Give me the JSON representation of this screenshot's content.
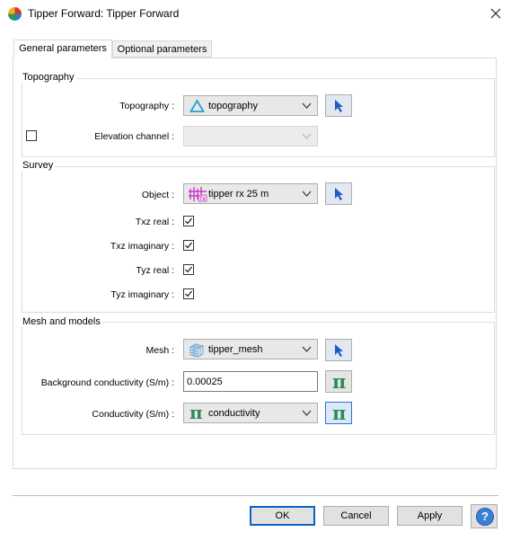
{
  "window": {
    "title": "Tipper Forward: Tipper Forward"
  },
  "tabs": [
    {
      "label": "General parameters"
    },
    {
      "label": "Optional parameters"
    }
  ],
  "topography": {
    "group_title": "Topography",
    "topography_label": "Topography :",
    "topography_value": "topography",
    "elevation_label": "Elevation channel :"
  },
  "survey": {
    "group_title": "Survey",
    "object_label": "Object :",
    "object_value": "tipper rx 25 m",
    "components": [
      {
        "label": "Txz real :",
        "checked": true
      },
      {
        "label": "Txz imaginary :",
        "checked": true
      },
      {
        "label": "Tyz real :",
        "checked": true
      },
      {
        "label": "Tyz imaginary :",
        "checked": true
      }
    ]
  },
  "mesh": {
    "group_title": "Mesh and models",
    "mesh_label": "Mesh :",
    "mesh_value": "tipper_mesh",
    "background_label": "Background conductivity (S/m) :",
    "background_value": "0.00025",
    "conductivity_label": "Conductivity (S/m) :",
    "conductivity_value": "conductivity",
    "pi_symbol": "π"
  },
  "buttons": {
    "ok": "OK",
    "cancel": "Cancel",
    "apply": "Apply",
    "help": "?"
  },
  "colors": {
    "accent": "#0a64c8",
    "pi_green": "#2e8b57",
    "arrow_blue": "#1e5bc8"
  }
}
